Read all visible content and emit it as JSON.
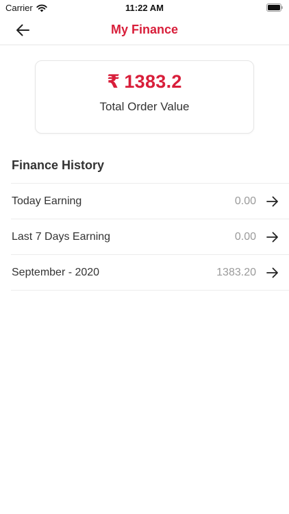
{
  "status_bar": {
    "carrier": "Carrier",
    "time": "11:22 AM"
  },
  "header": {
    "title": "My Finance",
    "back_icon": "arrow-left-icon"
  },
  "summary": {
    "currency_symbol": "₹",
    "amount": "1383.2",
    "label": "Total Order Value"
  },
  "history": {
    "title": "Finance History",
    "rows": [
      {
        "label": "Today Earning",
        "value": "0.00"
      },
      {
        "label": "Last 7 Days Earning",
        "value": "0.00"
      },
      {
        "label": "September - 2020",
        "value": "1383.20"
      }
    ],
    "row_icon": "arrow-right-icon"
  },
  "colors": {
    "accent": "#d81e3a",
    "muted_value": "#9a9a9a",
    "divider": "#ececec"
  }
}
